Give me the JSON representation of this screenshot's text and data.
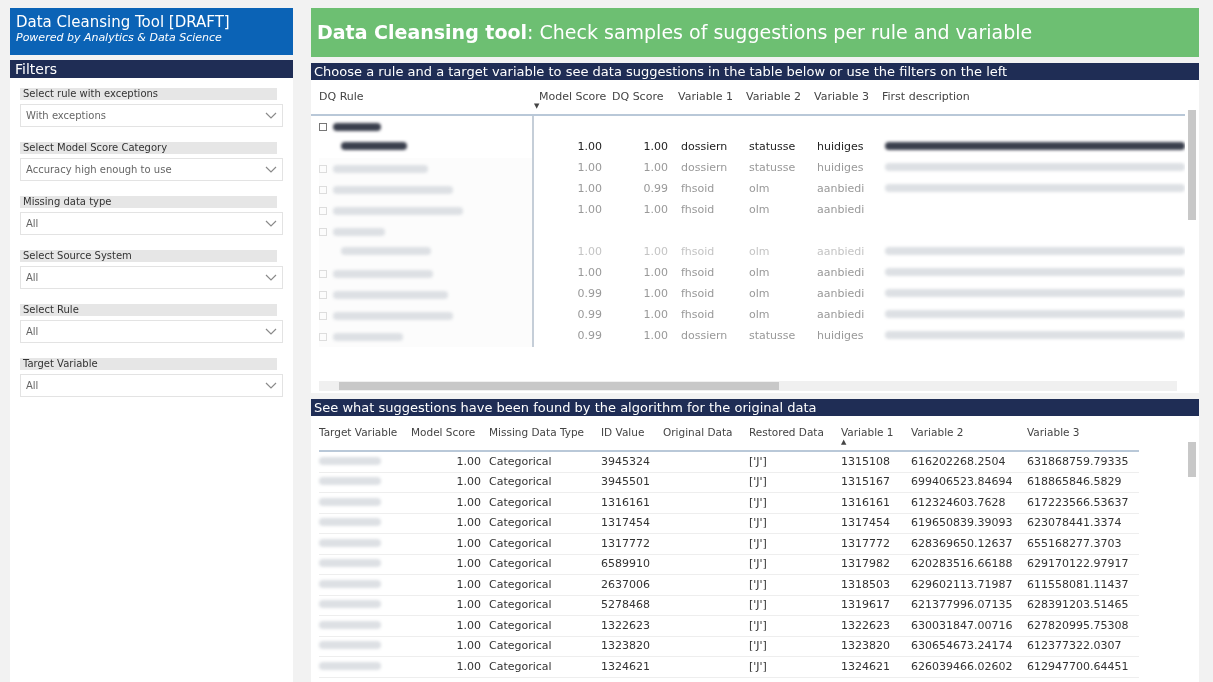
{
  "app": {
    "title": "Data Cleansing Tool [DRAFT]",
    "subtitle": "Powered by Analytics & Data Science"
  },
  "filters": {
    "title": "Filters",
    "items": [
      {
        "label": "Select rule with exceptions",
        "value": "With exceptions"
      },
      {
        "label": "Select Model Score Category",
        "value": "Accuracy high enough to use"
      },
      {
        "label": "Missing data type",
        "value": "All"
      },
      {
        "label": "Select Source System",
        "value": "All"
      },
      {
        "label": "Select Rule",
        "value": "All"
      },
      {
        "label": "Target Variable",
        "value": "All"
      }
    ]
  },
  "banner": {
    "title": "Data Cleansing tool",
    "subtitle": ": Check samples of suggestions per rule and variable"
  },
  "rules_table": {
    "caption": "Choose a rule and a target variable to see data suggestions in the table below or use the filters on the left",
    "columns": [
      {
        "label": "DQ Rule"
      },
      {
        "label": "Model Score",
        "sort_mark": "▼"
      },
      {
        "label": "DQ Score"
      },
      {
        "label": "Variable 1"
      },
      {
        "label": "Variable 2"
      },
      {
        "label": "Variable 3"
      },
      {
        "label": "First description"
      }
    ],
    "rows": [
      {
        "kind": "group",
        "selected": true
      },
      {
        "kind": "child",
        "selected": true,
        "values": [
          "1.00",
          "1.00",
          "dossiern",
          "statusse",
          "huidiges"
        ]
      },
      {
        "kind": "rule",
        "selected": false,
        "values": [
          "1.00",
          "1.00",
          "dossiern",
          "statusse",
          "huidiges"
        ]
      },
      {
        "kind": "rule",
        "selected": false,
        "values": [
          "1.00",
          "0.99",
          "fhsoid",
          "olm",
          "aanbiedi"
        ]
      },
      {
        "kind": "rule",
        "selected": false,
        "values": [
          "1.00",
          "1.00",
          "fhsoid",
          "olm",
          "aanbiedi"
        ]
      },
      {
        "kind": "group",
        "selected": false
      },
      {
        "kind": "child",
        "selected": false,
        "values": [
          "1.00",
          "1.00",
          "fhsoid",
          "olm",
          "aanbiedi"
        ]
      },
      {
        "kind": "rule",
        "selected": false,
        "values": [
          "1.00",
          "1.00",
          "fhsoid",
          "olm",
          "aanbiedi"
        ]
      },
      {
        "kind": "rule",
        "selected": false,
        "values": [
          "0.99",
          "1.00",
          "fhsoid",
          "olm",
          "aanbiedi"
        ]
      },
      {
        "kind": "rule",
        "selected": false,
        "values": [
          "0.99",
          "1.00",
          "fhsoid",
          "olm",
          "aanbiedi"
        ]
      },
      {
        "kind": "rule",
        "selected": false,
        "values": [
          "0.99",
          "1.00",
          "dossiern",
          "statusse",
          "huidiges"
        ]
      }
    ]
  },
  "suggestions_table": {
    "caption": "See what suggestions have been found by the algorithm for the original data",
    "columns": [
      {
        "label": "Target Variable"
      },
      {
        "label": "Model Score"
      },
      {
        "label": "Missing Data Type"
      },
      {
        "label": "ID Value"
      },
      {
        "label": "Original Data"
      },
      {
        "label": "Restored Data"
      },
      {
        "label": "Variable 1",
        "sort_mark": "▲"
      },
      {
        "label": "Variable 2"
      },
      {
        "label": "Variable 3"
      }
    ],
    "rows": [
      [
        "",
        "1.00",
        "Categorical",
        "3945324",
        "",
        "['J']",
        "1315108",
        "616202268.2504",
        "631868759.79335"
      ],
      [
        "",
        "1.00",
        "Categorical",
        "3945501",
        "",
        "['J']",
        "1315167",
        "699406523.84694",
        "618865846.5829"
      ],
      [
        "",
        "1.00",
        "Categorical",
        "1316161",
        "",
        "['J']",
        "1316161",
        "612324603.7628",
        "617223566.53637"
      ],
      [
        "",
        "1.00",
        "Categorical",
        "1317454",
        "",
        "['J']",
        "1317454",
        "619650839.39093",
        "623078441.3374"
      ],
      [
        "",
        "1.00",
        "Categorical",
        "1317772",
        "",
        "['J']",
        "1317772",
        "628369650.12637",
        "655168277.3703"
      ],
      [
        "",
        "1.00",
        "Categorical",
        "6589910",
        "",
        "['J']",
        "1317982",
        "620283516.66188",
        "629170122.97917"
      ],
      [
        "",
        "1.00",
        "Categorical",
        "2637006",
        "",
        "['J']",
        "1318503",
        "629602113.71987",
        "611558081.11437"
      ],
      [
        "",
        "1.00",
        "Categorical",
        "5278468",
        "",
        "['J']",
        "1319617",
        "621377996.07135",
        "628391203.51465"
      ],
      [
        "",
        "1.00",
        "Categorical",
        "1322623",
        "",
        "['J']",
        "1322623",
        "630031847.00716",
        "627820995.75308"
      ],
      [
        "",
        "1.00",
        "Categorical",
        "1323820",
        "",
        "['J']",
        "1323820",
        "630654673.24174",
        "612377322.0307"
      ],
      [
        "",
        "1.00",
        "Categorical",
        "1324621",
        "",
        "['J']",
        "1324621",
        "626039466.02602",
        "612947700.64451"
      ]
    ]
  }
}
